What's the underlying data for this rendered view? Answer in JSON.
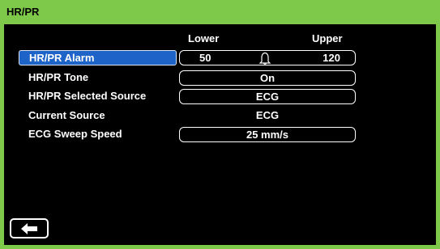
{
  "header": {
    "title": "HR/PR"
  },
  "columns": {
    "lower": "Lower",
    "upper": "Upper"
  },
  "rows": {
    "alarm": {
      "label": "HR/PR Alarm",
      "lower": "50",
      "upper": "120"
    },
    "tone": {
      "label": "HR/PR Tone",
      "value": "On"
    },
    "selected_source": {
      "label": "HR/PR Selected Source",
      "value": "ECG"
    },
    "current_source": {
      "label": "Current Source",
      "value": "ECG"
    },
    "sweep_speed": {
      "label": "ECG Sweep Speed",
      "value": "25 mm/s"
    }
  },
  "icons": {
    "alarm": "bell-icon",
    "back": "back-arrow-icon"
  },
  "colors": {
    "accent": "#7ec84a",
    "selection": "#1e64c8",
    "background": "#000000"
  }
}
